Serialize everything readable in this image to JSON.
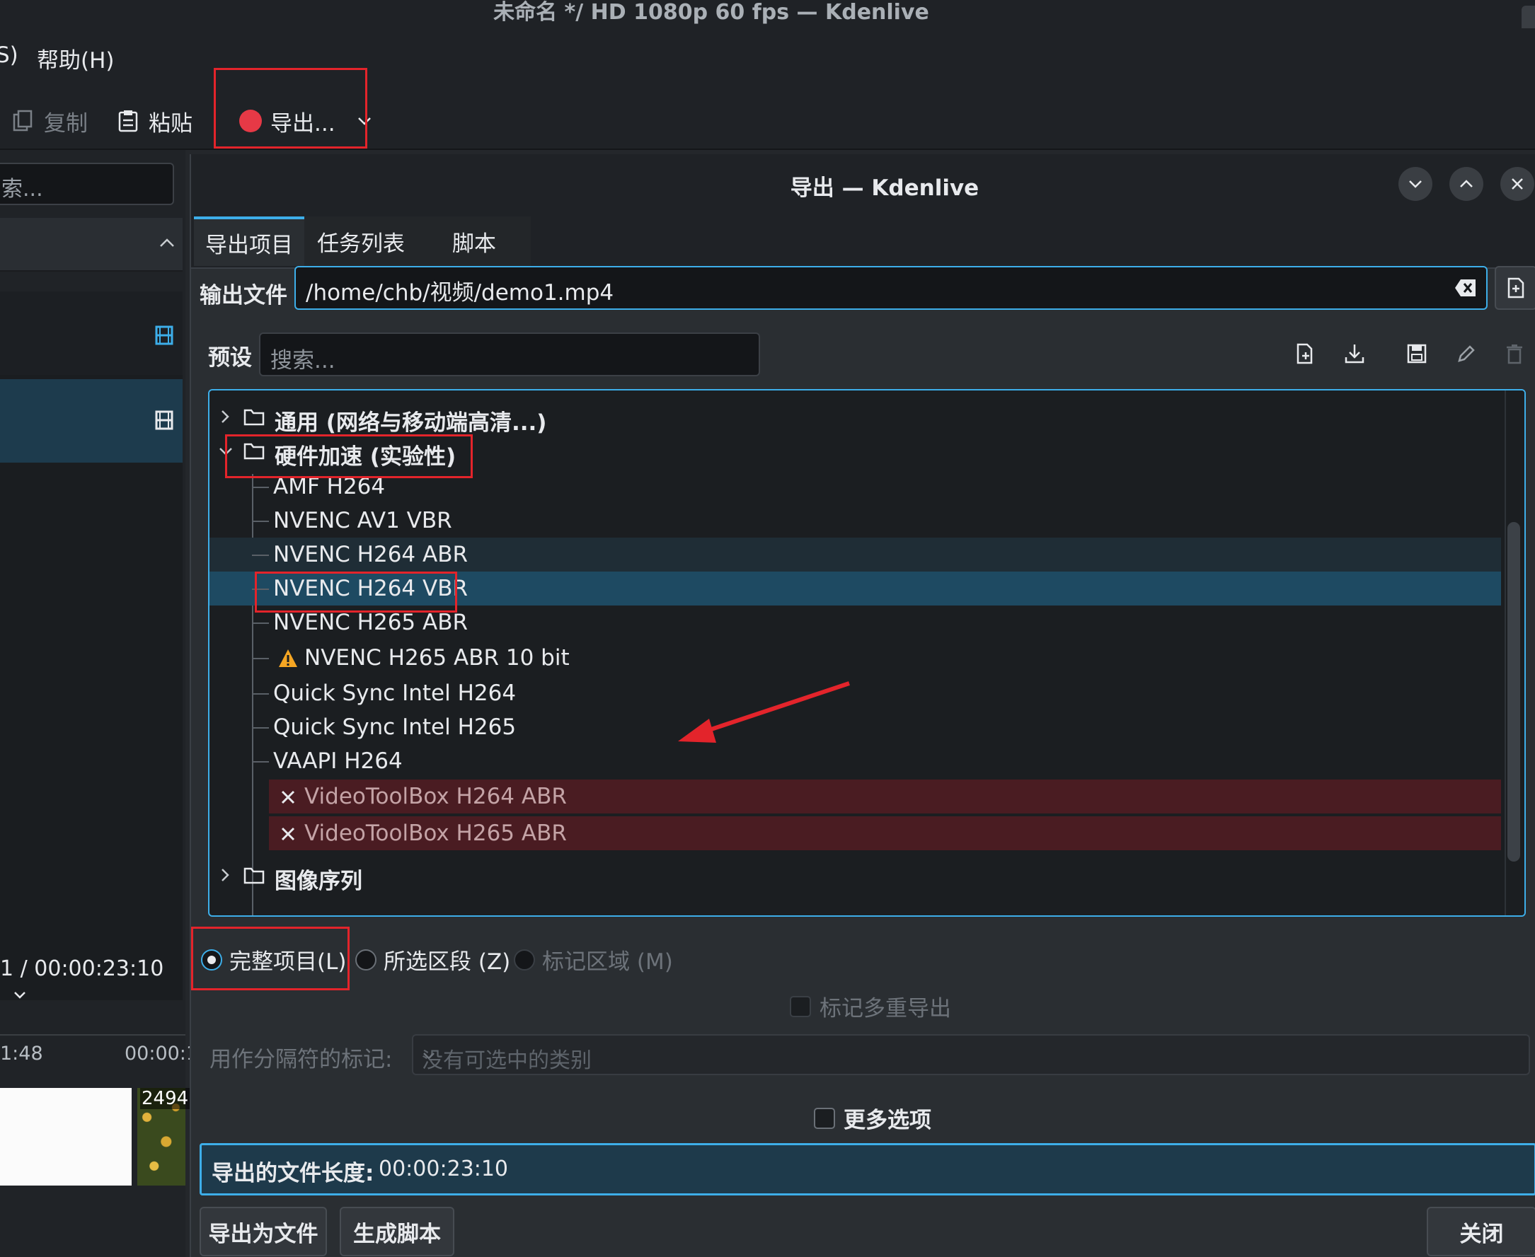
{
  "window": {
    "title": "未命名 */ HD 1080p 60 fps — Kdenlive"
  },
  "menubar": {
    "partial": "S)",
    "help": "帮助(H)"
  },
  "toolbar": {
    "copy": "复制",
    "paste": "粘贴",
    "render": "导出..."
  },
  "left_panel": {
    "search_placeholder": "索...",
    "timecode": "1 / 00:00:23:10",
    "ruler_left": "1:48",
    "ruler_right": "00:00:1",
    "thumb_label": "2494"
  },
  "dialog": {
    "title": "导出 — Kdenlive",
    "tabs": [
      "导出项目",
      "任务列表",
      "脚本"
    ],
    "output_label": "输出文件",
    "output_value": "/home/chb/视频/demo1.mp4",
    "preset_label": "预设",
    "preset_search_placeholder": "搜索...",
    "tree": {
      "folder_general": "通用 (网络与移动端高清...)",
      "folder_hw": "硬件加速 (实验性)",
      "items": [
        "AMF H264",
        "NVENC AV1 VBR",
        "NVENC H264 ABR",
        "NVENC H264 VBR",
        "NVENC H265 ABR",
        "NVENC H265 ABR 10 bit",
        "Quick Sync Intel H264",
        "Quick Sync Intel H265",
        "VAAPI H264",
        "VideoToolBox H264 ABR",
        "VideoToolBox H265 ABR"
      ],
      "selected_item": "NVENC H264 VBR",
      "folder_images": "图像序列"
    },
    "range": {
      "full": "完整项目(L)",
      "selected": "所选区段 (Z)",
      "marked": "标记区域 (M)",
      "current": "完整项目(L)"
    },
    "multi_export": "标记多重导出",
    "separator_label": "用作分隔符的标记:",
    "separator_placeholder": "没有可选中的类别",
    "more_options": "更多选项",
    "length_label": "导出的文件长度:",
    "length_value": "00:00:23:10",
    "buttons": {
      "render_to_file": "导出为文件",
      "generate_script": "生成脚本",
      "close": "关闭"
    }
  },
  "colors": {
    "accent": "#3daee9",
    "annotation_red": "#e3242b",
    "error_row": "#4a1c22",
    "warning": "#f5a623"
  }
}
